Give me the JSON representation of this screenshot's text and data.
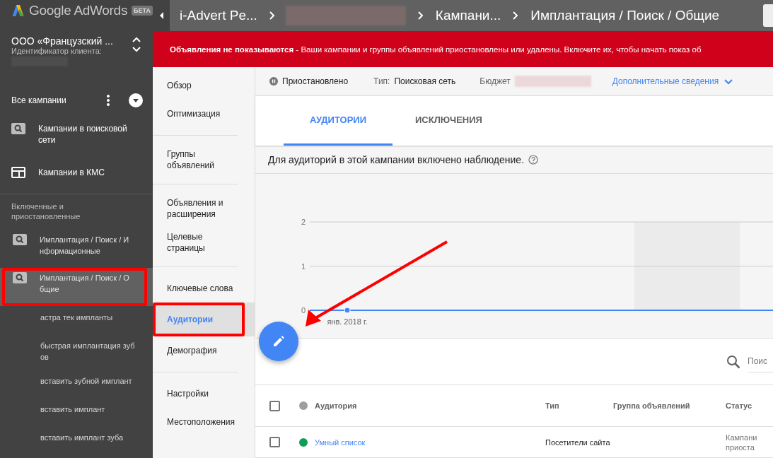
{
  "sidebar": {
    "logo": {
      "text": "Google AdWords",
      "badge": "БЕТА"
    },
    "account": {
      "name": "ООО «Французский ...",
      "label": "Идентификатор клиента:"
    },
    "all_campaigns": {
      "label": "Все кампании"
    },
    "campaign_types": [
      {
        "kind": "search",
        "label": "Кампании в поисковой сети"
      },
      {
        "kind": "display",
        "label": "Кампании в КМС"
      }
    ],
    "section_title": "Включенные и приостановленные",
    "items": [
      {
        "kind": "campaign",
        "label": "Имплантация / Поиск / Информационные",
        "selected": false,
        "highlighted": false
      },
      {
        "kind": "campaign",
        "label": "Имплантация / Поиск / Общие",
        "selected": true,
        "highlighted": true
      },
      {
        "kind": "adgroup",
        "label": "астра тек импланты",
        "selected": false,
        "highlighted": false
      },
      {
        "kind": "adgroup",
        "label": "быстрая имплантация зубов",
        "selected": false,
        "highlighted": false
      },
      {
        "kind": "adgroup",
        "label": "вставить зубной имплант",
        "selected": false,
        "highlighted": false
      },
      {
        "kind": "adgroup",
        "label": "вставить имплант",
        "selected": false,
        "highlighted": false
      },
      {
        "kind": "adgroup",
        "label": "вставить имплант зуба",
        "selected": false,
        "highlighted": false
      }
    ]
  },
  "breadcrumbs": [
    {
      "kind": "text",
      "text": "i-Advert Pe..."
    },
    {
      "kind": "redacted"
    },
    {
      "kind": "text",
      "text": "Кампани..."
    },
    {
      "kind": "text",
      "text": "Имплантация / Поиск / Общие"
    }
  ],
  "banner": {
    "text": "**Объявления не показываются** - Ваши кампании и группы объявлений приостановлены или удалены. Включите их, чтобы начать показ об"
  },
  "nav_groups": [
    [
      {
        "label": "Обзор",
        "selected": false,
        "highlighted": false
      },
      {
        "label": "Оптимизация",
        "selected": false,
        "highlighted": false
      }
    ],
    [
      {
        "label": "Группы объявлений",
        "selected": false,
        "highlighted": false
      }
    ],
    [
      {
        "label": "Объявления и расширения",
        "selected": false,
        "highlighted": false
      },
      {
        "label": "Целевые страницы",
        "selected": false,
        "highlighted": false
      }
    ],
    [
      {
        "label": "Ключевые слова",
        "selected": false,
        "highlighted": false
      },
      {
        "label": "Аудитории",
        "selected": true,
        "highlighted": true
      },
      {
        "label": "Демография",
        "selected": false,
        "highlighted": false
      }
    ],
    [
      {
        "label": "Настройки",
        "selected": false,
        "highlighted": false
      },
      {
        "label": "Местоположения",
        "selected": false,
        "highlighted": false
      }
    ]
  ],
  "status": {
    "state": "Приостановлено",
    "type_label": "Тип:",
    "type_value": "Поисковая сеть",
    "budget_label": "Бюджет",
    "details_link": "Дополнительные сведения"
  },
  "tabs": [
    {
      "label": "АУДИТОРИИ",
      "selected": true
    },
    {
      "label": "ИСКЛЮЧЕНИЯ",
      "selected": false
    }
  ],
  "notice": "Для аудиторий в этой кампании включено наблюдение.",
  "chart": {
    "chart_data": {
      "type": "line",
      "categories": [
        "янв. 2018 г."
      ],
      "ylim": [
        0,
        2
      ],
      "yticks": [
        0,
        1,
        2
      ],
      "series": [
        {
          "color": "#4285f4",
          "marker": "circle",
          "values": [
            0
          ]
        }
      ]
    }
  },
  "search": {
    "placeholder": "Поис"
  },
  "table": {
    "all_checked": false,
    "columns": [
      "Аудитория",
      "Тип",
      "Группа объявлений",
      "Статус"
    ],
    "rows": [
      {
        "checked": false,
        "color": "#0f9d58",
        "audience": "Умный список",
        "type": "Посетители сайта",
        "status": "Кампани приоста"
      }
    ]
  }
}
